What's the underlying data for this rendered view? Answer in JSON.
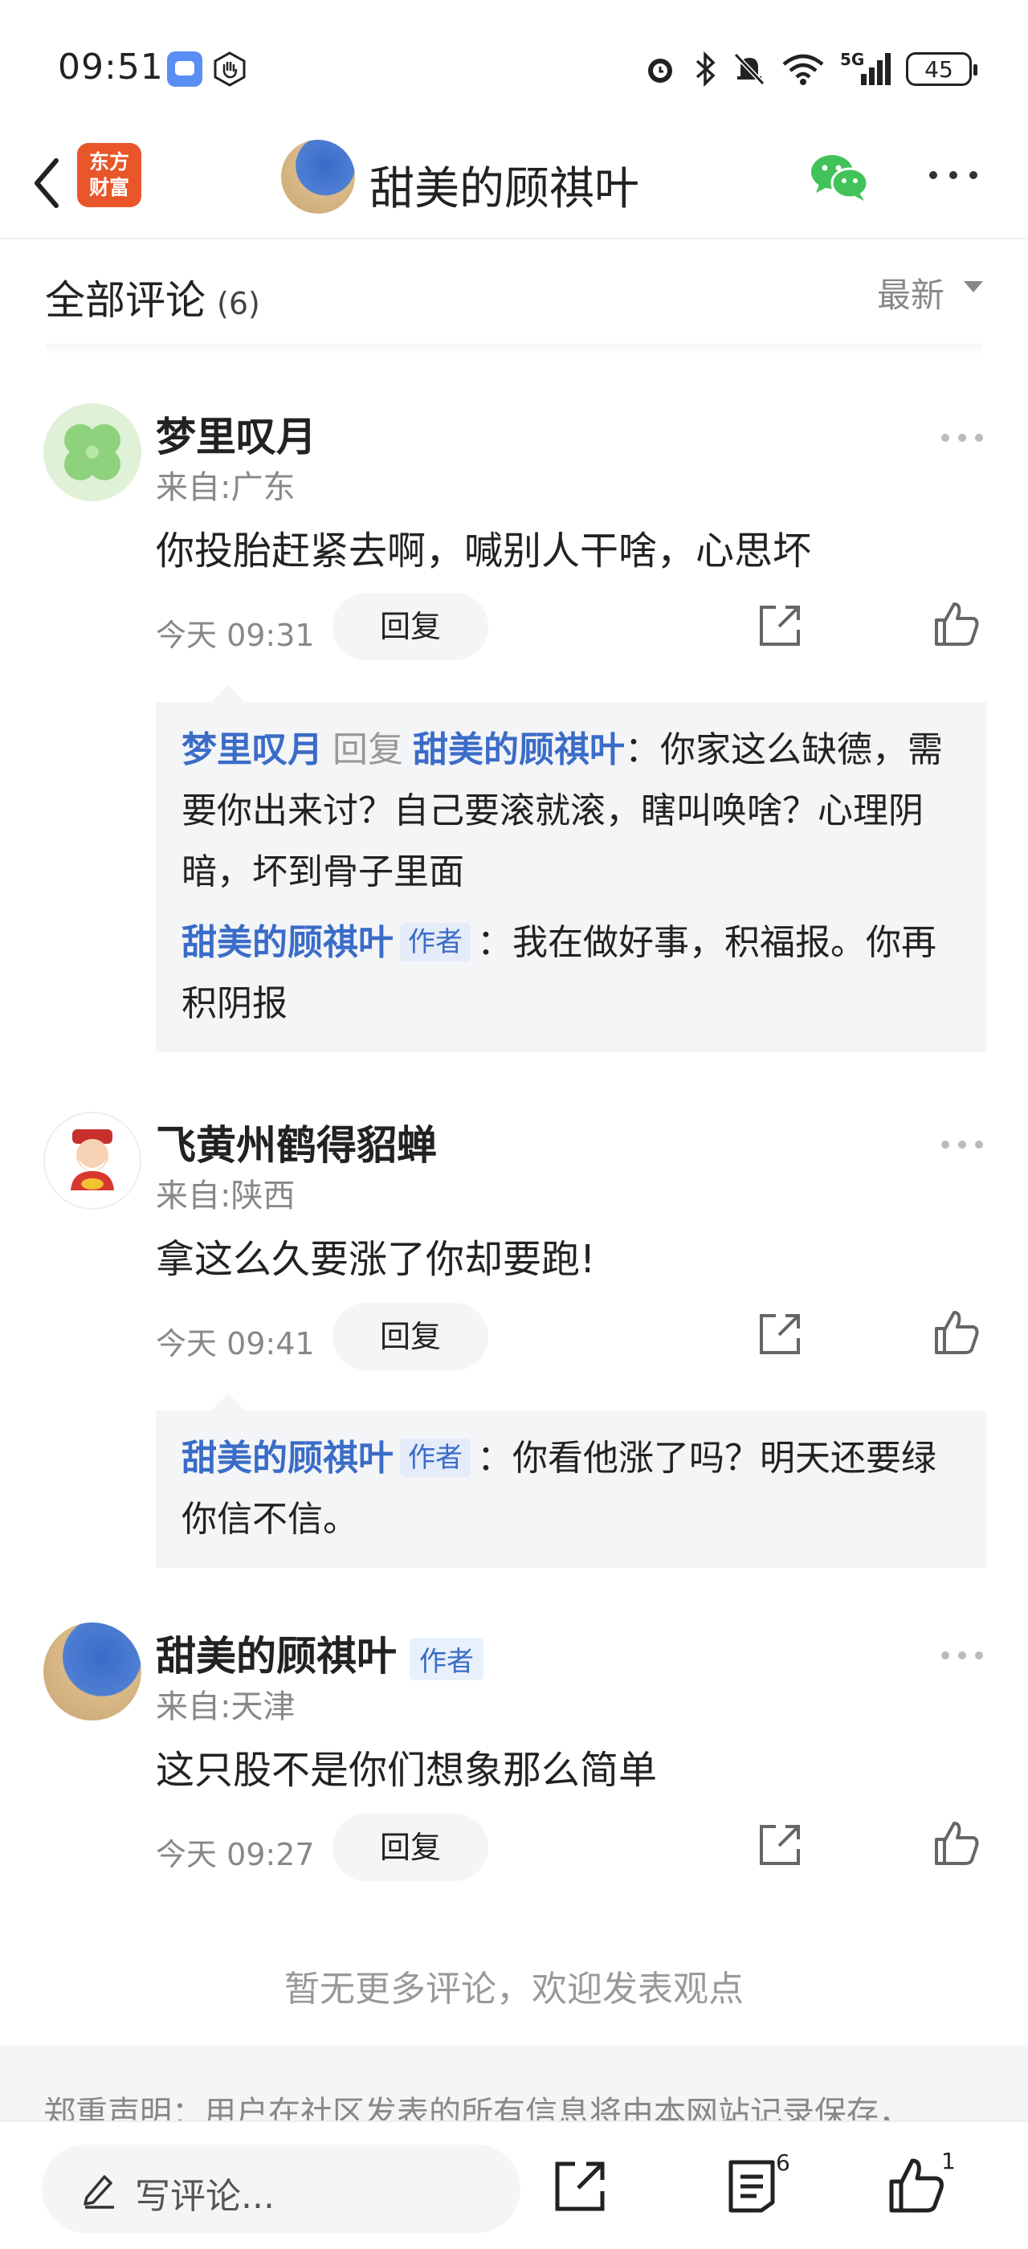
{
  "status_bar": {
    "time": "09:51",
    "signal_label": "5G",
    "battery": "45"
  },
  "header": {
    "logo_text": "东方\n财富",
    "title": "甜美的顾祺叶"
  },
  "section": {
    "title": "全部评论",
    "count": "(6)",
    "sort_label": "最新"
  },
  "comments": [
    {
      "name": "梦里叹月",
      "location": "来自:广东",
      "text": "你投胎赶紧去啊，喊别人干啥，心思坏",
      "time": "今天 09:31",
      "reply_label": "回复",
      "replies": [
        {
          "user": "梦里叹月",
          "reply_word": "回复",
          "target": "甜美的顾祺叶",
          "text": "你家这么缺德，需要你出来讨？自己要滚就滚，瞎叫唤啥？心理阴暗，坏到骨子里面"
        },
        {
          "user": "甜美的顾祺叶",
          "tag": "作者",
          "text": "我在做好事，积福报。你再积阴报"
        }
      ]
    },
    {
      "name": "飞黄州鹤得貂蝉",
      "location": "来自:陕西",
      "text": "拿这么久要涨了你却要跑!",
      "time": "今天 09:41",
      "reply_label": "回复",
      "replies": [
        {
          "user": "甜美的顾祺叶",
          "tag": "作者",
          "text": "你看他涨了吗？明天还要绿你信不信。"
        }
      ]
    },
    {
      "name": "甜美的顾祺叶",
      "tag": "作者",
      "location": "来自:天津",
      "text": "这只股不是你们想象那么简单",
      "time": "今天 09:27",
      "reply_label": "回复"
    }
  ],
  "no_more": "暂无更多评论，欢迎发表观点",
  "notice": "郑重声明：用户在社区发表的所有信息将由本网站记录保存，",
  "bottom_bar": {
    "comment_placeholder": "写评论...",
    "list_count": "6",
    "like_count": "1"
  },
  "colors": {
    "link_blue": "#3a6cc8",
    "logo_orange": "#e8562a",
    "wechat_green": "#41c35a",
    "muted_gray": "#888888"
  },
  "icons": [
    "back-icon",
    "wechat-icon",
    "more-icon",
    "share-icon",
    "like-icon",
    "pencil-icon",
    "list-icon"
  ]
}
